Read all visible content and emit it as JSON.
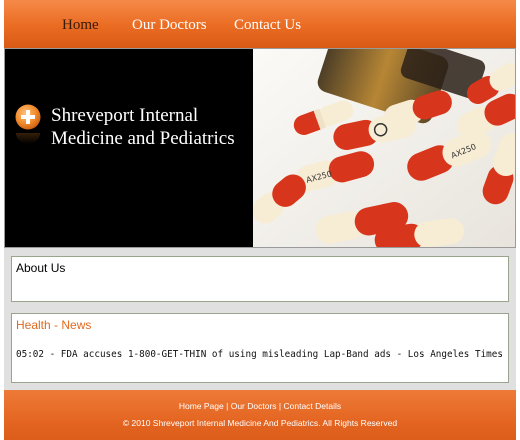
{
  "nav": {
    "items": [
      {
        "label": "Home",
        "active": true
      },
      {
        "label": "Our Doctors",
        "active": false
      },
      {
        "label": "Contact Us",
        "active": false
      }
    ]
  },
  "banner": {
    "title_line1": "Shreveport Internal",
    "title_line2": "Medicine and Pediatrics",
    "logo_icon": "plus-circle-icon",
    "image": "capsules-photo"
  },
  "about": {
    "title": "About Us"
  },
  "news": {
    "title": "Health - News",
    "items": [
      "05:02 - FDA accuses 1-800-GET-THIN of using misleading Lap-Band ads - Los Angeles Times"
    ]
  },
  "footer": {
    "links": [
      "Home Page",
      "Our Doctors",
      "Contact Details"
    ],
    "separator": "|",
    "copyright": "© 2010 Shreveport Internal Medicine And Pediatrics. All Rights Reserved"
  },
  "colors": {
    "accent": "#e8671f",
    "news_title": "#e06a20",
    "box_border": "#9aa48c"
  }
}
